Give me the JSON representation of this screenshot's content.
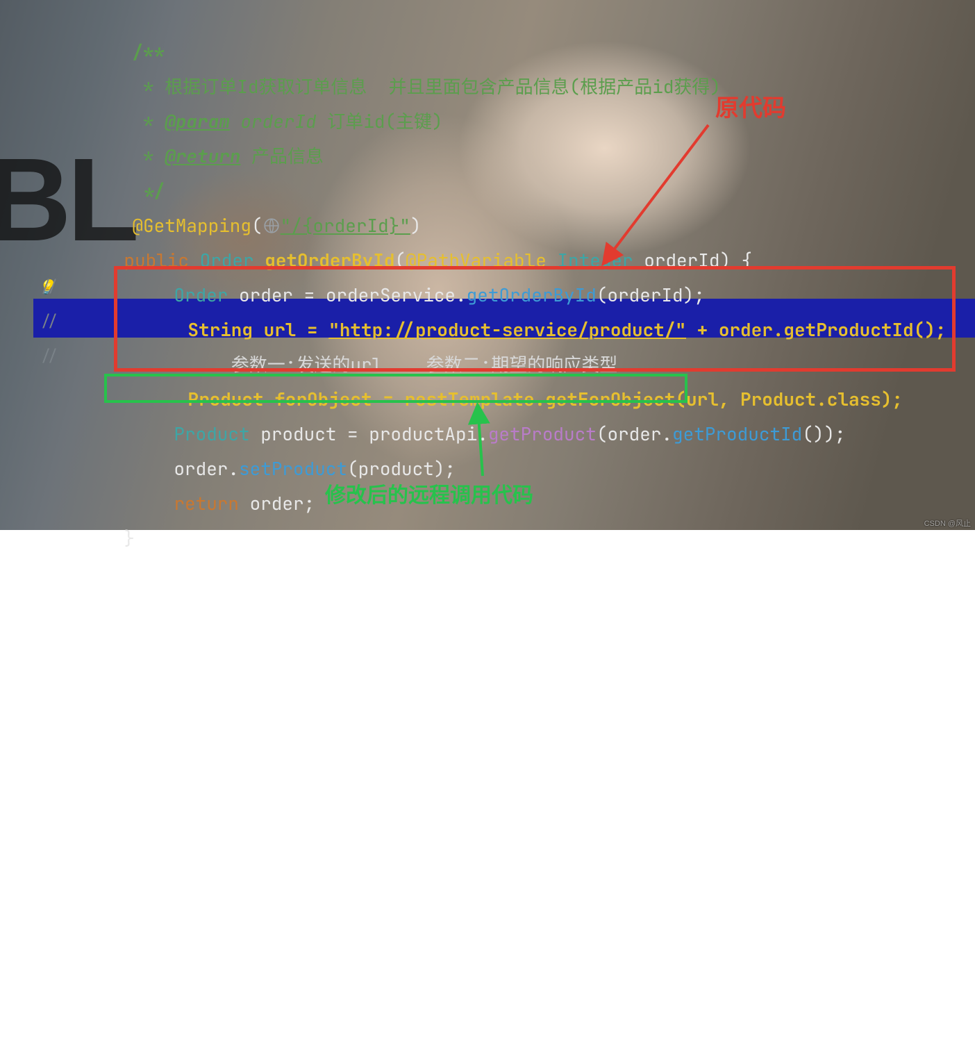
{
  "javadoc": {
    "open": "/**",
    "line1_star": " * ",
    "line1_text": "根据订单Id获取订单信息  并且里面包含产品信息(根据产品id获得)",
    "line2_star": " * ",
    "param_tag": "@param",
    "param_name": " orderId ",
    "param_desc": "订单id(主键)",
    "line3_star": " * ",
    "return_tag": "@return",
    "return_desc": " 产品信息",
    "close": " */"
  },
  "mapping": {
    "ann": "@GetMapping",
    "lparen": "(",
    "icon": "globe-icon",
    "path": "\"/{orderId}\"",
    "rparen": ")"
  },
  "sig": {
    "kw_public": "public ",
    "type": "Order ",
    "method": "getOrderById",
    "lparen": "(",
    "pv": "@PathVariable ",
    "ptype": "Integer ",
    "pname": "orderId",
    "rparen_brace": ") {"
  },
  "l1": {
    "type": "Order ",
    "var": "order = orderService.",
    "call": "getOrderById",
    "args": "(orderId);"
  },
  "gutter": {
    "m_bulb": "//",
    "m2": "//",
    "m3": "//"
  },
  "old": {
    "l1a": "String url = ",
    "l1b": "\"http://product-service/product/\"",
    "l1c": " + order.getProductId();",
    "l2": "    参数一:发送的url    参数二:期望的响应类型",
    "l3": "Product forObject = restTemplate.getForObject(url, Product.class);"
  },
  "new": {
    "type": "Product ",
    "var": "product = productApi.",
    "call": "getProduct",
    "mid": "(order.",
    "call2": "getProductId",
    "end": "());"
  },
  "l5": {
    "a": "order.",
    "call": "setProduct",
    "b": "(product);"
  },
  "l6": {
    "kw": "return ",
    "v": "order;"
  },
  "closebrace": "}",
  "annotations": {
    "original": "原代码",
    "modified": "修改后的远程调用代码"
  },
  "watermark": "CSDN @风止"
}
